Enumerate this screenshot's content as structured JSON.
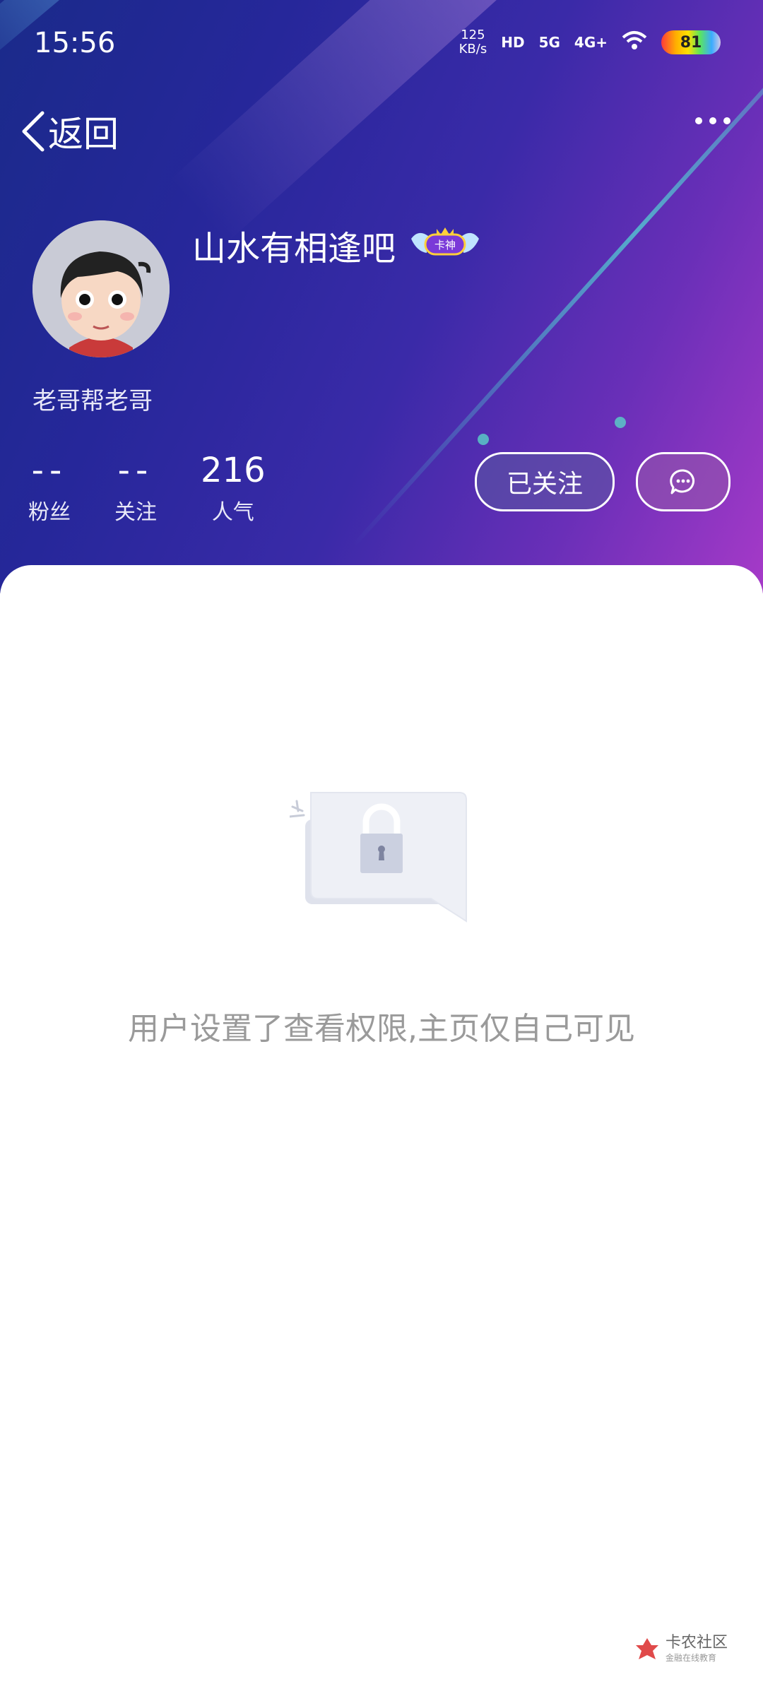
{
  "status_bar": {
    "time": "15:56",
    "net_speed_value": "125",
    "net_speed_unit": "KB/s",
    "hd_label": "HD",
    "sig1_label": "5G",
    "sig2_label": "4G+",
    "battery": "81"
  },
  "nav": {
    "back_label": "返回"
  },
  "profile": {
    "username": "山水有相逢吧",
    "badge_text": "卡神",
    "signature": "老哥帮老哥",
    "stats": [
      {
        "value": "--",
        "label": "粉丝"
      },
      {
        "value": "--",
        "label": "关注"
      },
      {
        "value": "216",
        "label": "人气"
      }
    ],
    "follow_label": "已关注"
  },
  "content": {
    "privacy_message": "用户设置了查看权限,主页仅自己可见"
  },
  "watermark": {
    "title": "卡农社区",
    "subtitle": "金融在线教育"
  },
  "colors": {
    "header_start": "#1a2a8a",
    "header_end": "#a63ac8",
    "message_text": "#9a9a9a"
  }
}
